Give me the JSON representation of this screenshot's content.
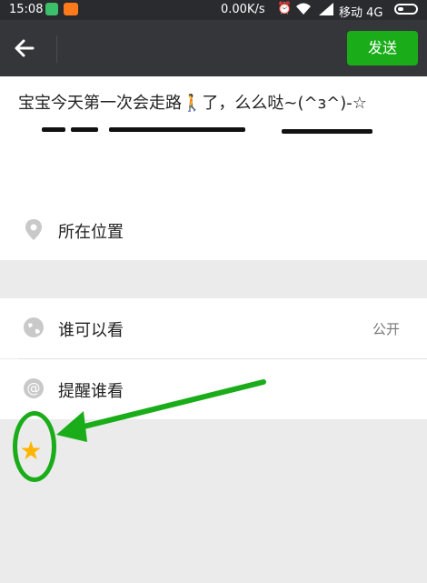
{
  "status_bar": {
    "time": "15:08",
    "network_speed": "0.00K/s",
    "carrier": "移动 4G"
  },
  "header": {
    "send_label": "发送"
  },
  "compose": {
    "text": "宝宝今天第一次会走路🚶了，么么哒~(^з^)-☆"
  },
  "rows": {
    "location_label": "所在位置",
    "visibility_label": "谁可以看",
    "visibility_value": "公开",
    "mention_label": "提醒谁看"
  },
  "colors": {
    "accent": "#1aad19",
    "topbar": "#34363a",
    "statusbar": "#2a2b2f",
    "star": "#ffb400"
  },
  "icons": {
    "back": "arrow-left-icon",
    "location": "map-pin-icon",
    "visibility": "globe-icon",
    "mention": "at-sign-icon",
    "star": "star-icon"
  }
}
